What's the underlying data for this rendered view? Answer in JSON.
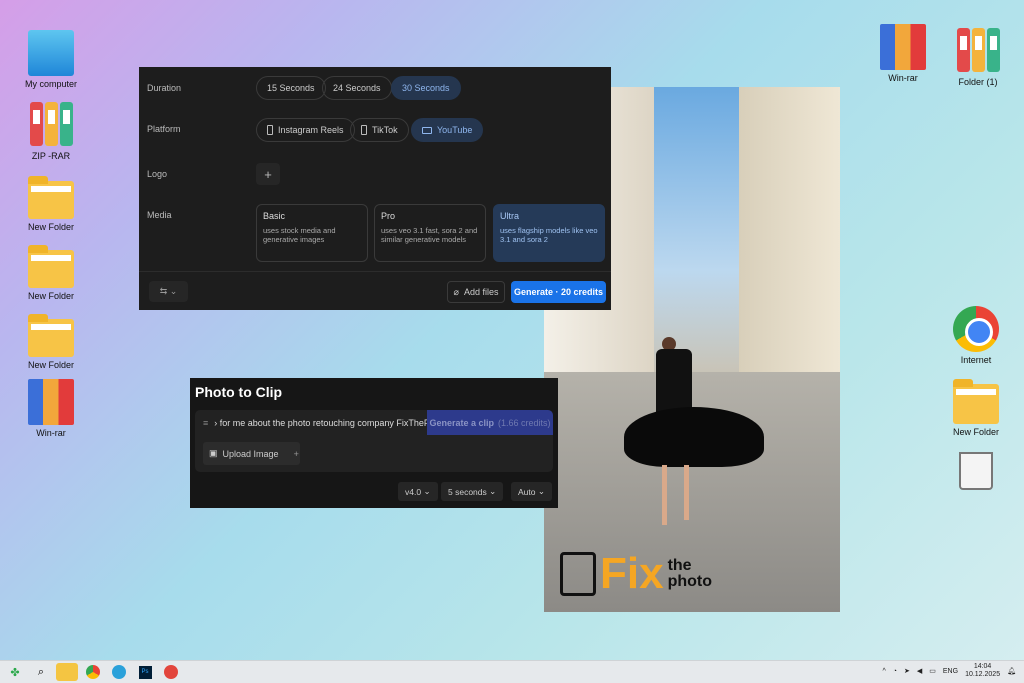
{
  "desktop": {
    "left_icons": [
      "My computer",
      "ZIP -RAR",
      "New Folder",
      "New Folder",
      "New Folder",
      "Win-rar"
    ],
    "right_icons": [
      "Win-rar",
      "Folder (1)",
      "Internet",
      "New Folder"
    ]
  },
  "video_panel": {
    "duration_label": "Duration",
    "durations": [
      "15 Seconds",
      "24 Seconds",
      "30 Seconds"
    ],
    "platform_label": "Platform",
    "platforms": [
      "Instagram Reels",
      "TikTok",
      "YouTube"
    ],
    "logo_label": "Logo",
    "logo_add": "+",
    "media_label": "Media",
    "media": [
      {
        "title": "Basic",
        "desc": "uses stock media and generative images"
      },
      {
        "title": "Pro",
        "desc": "uses veo 3.1 fast, sora 2 and similar generative models"
      },
      {
        "title": "Ultra",
        "desc": "uses flagship models like veo 3.1 and sora 2"
      }
    ],
    "add_files": "Add files",
    "generate": "Generate · 20 credits",
    "accent": "#1a73e8"
  },
  "clip_panel": {
    "title": "Photo to Clip",
    "prompt": "› for me about the photo retouching company FixThePhoto",
    "generate": "Generate a clip",
    "credits": "(1.66 credits)",
    "upload": "Upload Image",
    "upload_add": "+",
    "version": "v4.0",
    "length": "5 seconds",
    "ratio": "Auto"
  },
  "photo": {
    "logo_fix": "Fix",
    "logo_the": "the",
    "logo_photo": "photo"
  },
  "taskbar": {
    "lang": "ENG",
    "time": "14:04",
    "date": "10.12.2025"
  }
}
